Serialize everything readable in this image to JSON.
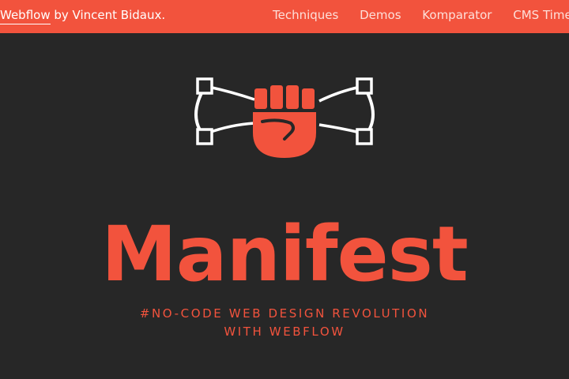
{
  "header": {
    "brand_prefix": "",
    "brand_link": "Webflow",
    "brand_suffix": " by Vincent Bidaux.",
    "nav": [
      "Techniques",
      "Demos",
      "Komparator",
      "CMS Time"
    ]
  },
  "hero": {
    "title": "Manifest",
    "tagline_line1": "#NO-CODE WEB DESIGN REVOLUTION",
    "tagline_line2": "WITH WEBFLOW"
  },
  "colors": {
    "accent": "#f2533d",
    "background": "#272727",
    "header_text": "#ffffff"
  },
  "icons": {
    "logo": "raised-fist-with-bezier-handles-icon"
  }
}
